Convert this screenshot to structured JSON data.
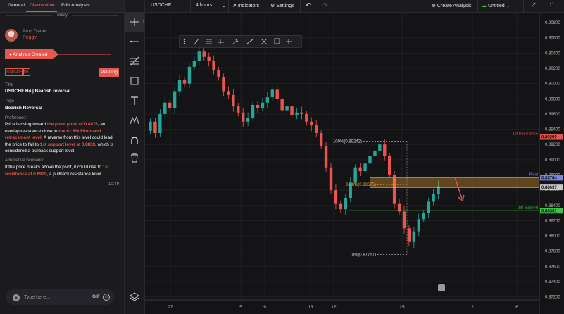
{
  "left_panel": {
    "tabs": {
      "general": "General",
      "discussion": "Discussion",
      "discussion_close": "×",
      "edit_analysis": "Edit Analysis"
    },
    "date_divider": "Today",
    "author": {
      "role": "Prop Trader",
      "name": "Peggy"
    },
    "status": "Analysis Created",
    "tags": [
      "USDCHF",
      "H4"
    ],
    "pending_label": "Pending",
    "title_label": "Title",
    "title_value": "USDCHF H4 | Bearish reversal",
    "type_label": "Type",
    "type_value": "Bearish Reversal",
    "preference_label": "Preference:",
    "preference": {
      "t1": "Price is rising toward ",
      "h1": "the pivot point of 0.8876",
      "t2": ", an overlap resistance close to ",
      "h2": "the 61.8% Fibonacci retracement level",
      "t3": ". A reverse from this level could lead the price to fall to ",
      "h3": "1st support level at 0.8833",
      "t4": ", which is considered a pullback support level."
    },
    "alternative_label": "Alternative Scenario:",
    "alternative": {
      "t1": "If the price breaks above the pivot, it could rise to ",
      "h1": "1st resistance at 0.8929",
      "t2": ", a pullback resistance level"
    },
    "timestamp": "10:49",
    "input_placeholder": "Type here...",
    "gif_label": "GIF"
  },
  "topbar": {
    "symbol": "USDCHF",
    "interval": "4 hours",
    "indicators": "Indicators",
    "settings": "Settings",
    "create_analysis": "Create Analysis",
    "layout_name": "Untitled"
  },
  "chart_data": {
    "type": "candlestick",
    "symbol": "USDCHF",
    "timeframe": "4 hours",
    "x_tick_labels": [
      "27",
      "5",
      "9",
      "13",
      "17",
      "25",
      "2",
      "6"
    ],
    "y_tick_labels": [
      "0.90800",
      "0.90600",
      "0.90400",
      "0.90200",
      "0.90000",
      "0.89800",
      "0.89600",
      "0.89400",
      "0.89200",
      "0.89000",
      "0.88800",
      "0.88600",
      "0.88400",
      "0.88200",
      "0.88000",
      "0.87800",
      "0.87600",
      "0.87400",
      "0.87200"
    ],
    "ylim": [
      0.8716,
      0.9093
    ],
    "closes": [
      0.895,
      0.8935,
      0.896,
      0.8975,
      0.8968,
      0.899,
      0.9005,
      0.9,
      0.9022,
      0.903,
      0.9042,
      0.9035,
      0.903,
      0.9018,
      0.9008,
      0.899,
      0.8985,
      0.897,
      0.8962,
      0.895,
      0.8955,
      0.8972,
      0.8968,
      0.8975,
      0.8982,
      0.8992,
      0.898,
      0.8965,
      0.897,
      0.8958,
      0.8962,
      0.896,
      0.895,
      0.8945,
      0.8935,
      0.8918,
      0.889,
      0.886,
      0.8842,
      0.8835,
      0.885,
      0.887,
      0.889,
      0.8885,
      0.8895,
      0.8905,
      0.8912,
      0.892,
      0.8905,
      0.888,
      0.8842,
      0.8832,
      0.881,
      0.8792,
      0.8806,
      0.8822,
      0.883,
      0.8845,
      0.8855,
      0.8865
    ],
    "horizontal_levels": [
      {
        "label": "1st Resistance",
        "price_label": "0.89299",
        "value": 0.89299,
        "color": "#e5564e"
      },
      {
        "label": "Pivot",
        "price_label": "0.88764",
        "value": 0.88764,
        "color": "#7a86e0"
      },
      {
        "label": "",
        "price_label": "0.88637",
        "value": 0.88637,
        "color": "#c8c8c8"
      },
      {
        "label": "1st Support",
        "price_label": "0.88331",
        "value": 0.88331,
        "color": "#3ec24a"
      }
    ],
    "fibonacci": [
      {
        "label": "100%(0.89242)",
        "value": 0.89242
      },
      {
        "label": "61.8%(0.88675)",
        "value": 0.88675
      },
      {
        "label": "0%(0.87757)",
        "value": 0.87757
      }
    ]
  },
  "colors": {
    "accent": "#e5564e",
    "up": "#26a69a",
    "down": "#ef5350",
    "support": "#3ec24a",
    "resistance": "#e5564e",
    "pivot_band": "#f0a030"
  }
}
